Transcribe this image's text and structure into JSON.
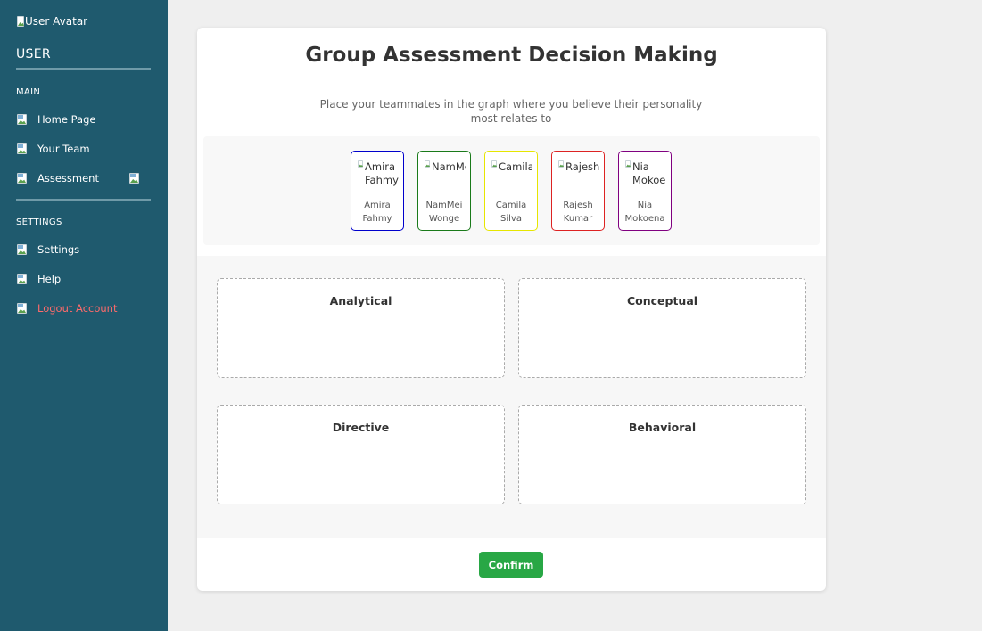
{
  "sidebar": {
    "avatar_alt": "User Avatar",
    "user_title": "USER",
    "main_section": "MAIN",
    "main_items": [
      {
        "label": "Home Page",
        "icon": "home-icon"
      },
      {
        "label": "Your Team",
        "icon": "team-icon"
      },
      {
        "label": "Assessment",
        "icon": "assessment-icon"
      }
    ],
    "settings_section": "SETTINGS",
    "settings_items": [
      {
        "label": "Settings",
        "icon": "settings-icon"
      },
      {
        "label": "Help",
        "icon": "help-icon"
      },
      {
        "label": "Logout Account",
        "icon": "logout-icon"
      }
    ],
    "colors": {
      "background": "#1f5a6e",
      "logout": "#ff6b6b"
    }
  },
  "main": {
    "title": "Group Assessment Decision Making",
    "subtitle": "Place your teammates in the graph where you believe their personality most relates to",
    "members": [
      {
        "alt": "Amira Fahmy",
        "name": "Amira Fahmy",
        "border": "#0000cc"
      },
      {
        "alt": "NamMei",
        "name": "NamMei Wonge",
        "border": "#1a7a1a"
      },
      {
        "alt": "Camila",
        "name": "Camila Silva",
        "border": "#e6e600"
      },
      {
        "alt": "Rajesh",
        "name": "Rajesh Kumar",
        "border": "#dd2222"
      },
      {
        "alt": "Nia Mokoen",
        "name": "Nia Mokoena",
        "border": "#800080"
      }
    ],
    "quadrants": [
      "Analytical",
      "Conceptual",
      "Directive",
      "Behavioral"
    ],
    "confirm_label": "Confirm",
    "colors": {
      "confirm": "#28a745"
    }
  }
}
